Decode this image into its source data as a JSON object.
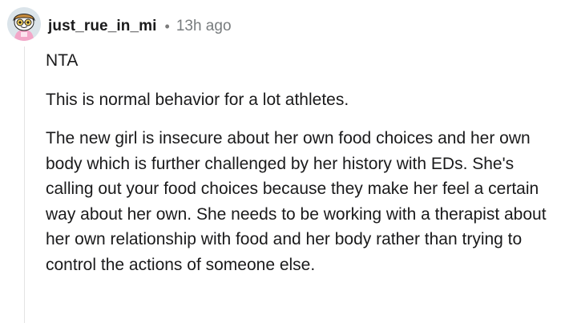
{
  "comment": {
    "author": "just_rue_in_mi",
    "separator": "•",
    "timestamp": "13h ago",
    "avatar_icon": "snoo-avatar-icon",
    "paragraphs": [
      "NTA",
      "This is normal behavior for a lot athletes.",
      "The new girl is insecure about her own food choices and her own body which is further challenged by her history with EDs. She's calling out your food choices because they make her feel a certain way about her own. She needs to be working with a therapist about her own relationship with food and her body rather than trying to control the actions of someone else."
    ]
  },
  "colors": {
    "text": "#1a1a1b",
    "meta": "#787c7e",
    "thread_line": "#e3e3e3",
    "avatar_bg": "#dbe4ea"
  }
}
